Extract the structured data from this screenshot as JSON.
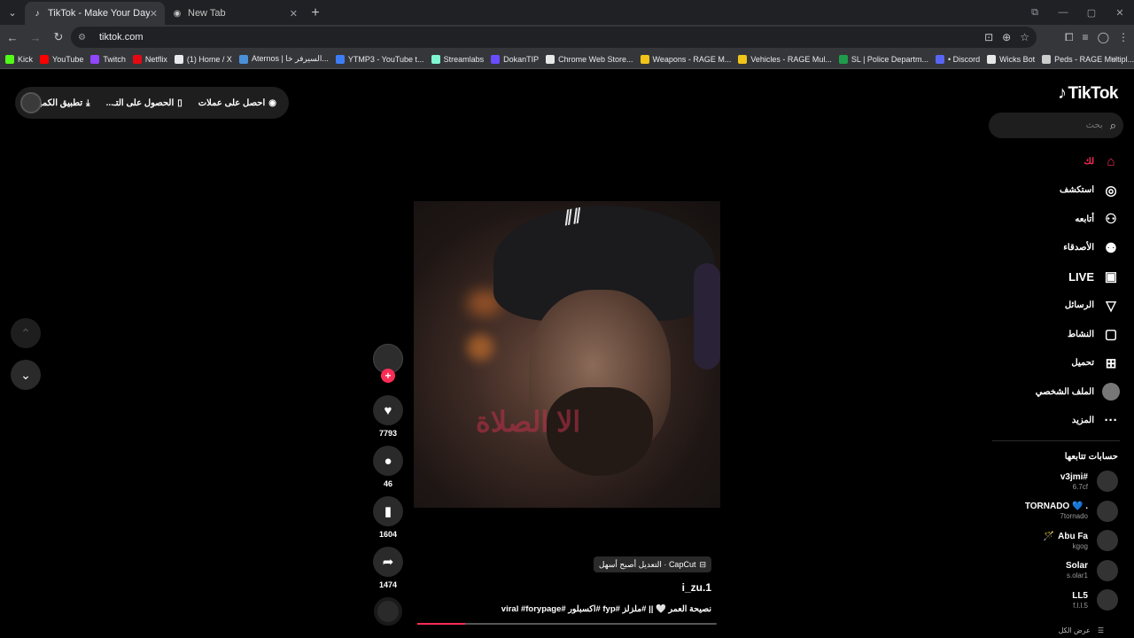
{
  "browser": {
    "tabs": [
      {
        "title": "TikTok - Make Your Day",
        "active": true
      },
      {
        "title": "New Tab",
        "active": false
      }
    ],
    "url": "tiktok.com",
    "bookmarks": [
      {
        "label": "Kick",
        "color": "#53fc18"
      },
      {
        "label": "YouTube",
        "color": "#ff0000"
      },
      {
        "label": "Twitch",
        "color": "#9146ff"
      },
      {
        "label": "Netflix",
        "color": "#e50914"
      },
      {
        "label": "(1) Home / X",
        "color": "#e8eaed"
      },
      {
        "label": "Aternos | السيرفر خا...",
        "color": "#4a90d9"
      },
      {
        "label": "YTMP3 - YouTube t...",
        "color": "#3d7ef7"
      },
      {
        "label": "Streamlabs",
        "color": "#80f5d2"
      },
      {
        "label": "DokanTIP",
        "color": "#6b4cff"
      },
      {
        "label": "Chrome Web Store...",
        "color": "#e8e8e8"
      },
      {
        "label": "Weapons - RAGE M...",
        "color": "#f0c419"
      },
      {
        "label": "Vehicles - RAGE Mul...",
        "color": "#f0c419"
      },
      {
        "label": "SL | Police Departm...",
        "color": "#1e9c4b"
      },
      {
        "label": "• Discord",
        "color": "#5865f2"
      },
      {
        "label": "Wicks Bot",
        "color": "#e8e8e8"
      },
      {
        "label": "Peds - RAGE Multipl...",
        "color": "#cccccc"
      }
    ]
  },
  "topbar": {
    "coins": "احصل على عملات",
    "get_app": "الحصول على التـ...",
    "desktop_app": "تطبيق الكمبيوتر"
  },
  "sidebar": {
    "logo": "TikTok",
    "search_placeholder": "بحث",
    "nav": [
      {
        "label": "لك",
        "icon": "home-icon",
        "glyph": "⌂",
        "active": true
      },
      {
        "label": "استكشف",
        "icon": "compass-icon",
        "glyph": "◎",
        "active": false
      },
      {
        "label": "أتابعه",
        "icon": "following-icon",
        "glyph": "⚇",
        "active": false
      },
      {
        "label": "الأصدقاء",
        "icon": "friends-icon",
        "glyph": "⚉",
        "active": false
      },
      {
        "label": "LIVE",
        "icon": "live-icon",
        "glyph": "▣",
        "active": false
      },
      {
        "label": "الرسائل",
        "icon": "messages-icon",
        "glyph": "▽",
        "active": false
      },
      {
        "label": "النشاط",
        "icon": "activity-icon",
        "glyph": "▢",
        "active": false
      },
      {
        "label": "تحميل",
        "icon": "upload-icon",
        "glyph": "⊞",
        "active": false
      },
      {
        "label": "الملف الشخصي",
        "icon": "profile-avatar",
        "glyph": "",
        "active": false
      },
      {
        "label": "المزيد",
        "icon": "more-icon",
        "glyph": "···",
        "active": false
      }
    ],
    "following_title": "حسابات تتابعها",
    "accounts": [
      {
        "name": "v3jmi#",
        "handle": "6.7cf",
        "prefix": ""
      },
      {
        "name": "TORNADO 💙 .",
        "handle": "7tornado",
        "prefix": ""
      },
      {
        "name": "Abu Fa",
        "handle": "kgog",
        "prefix": "🪄"
      },
      {
        "name": "Solar",
        "handle": "s.olar1",
        "prefix": ""
      },
      {
        "name": "LL5",
        "handle": "f.l.l.5",
        "prefix": ""
      }
    ],
    "see_all": "عرض الكل"
  },
  "video": {
    "capcut_label": "CapCut · التعديل أصبح أسهل",
    "username": "i_zu.1",
    "description": "نصيحة العمر 🤍 || #ملزلز #fyp #اكسبلور #viral #forypage",
    "progress": 0.16,
    "overlay_text": "الا الصلاة"
  },
  "actions": {
    "likes": "7793",
    "comments": "46",
    "saves": "1604",
    "shares": "1474"
  }
}
